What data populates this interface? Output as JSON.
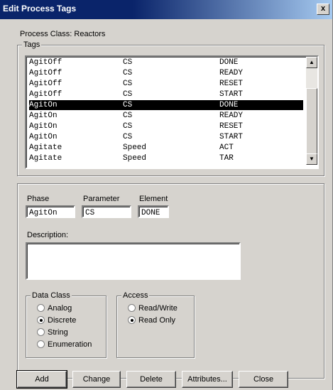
{
  "window": {
    "title": "Edit Process Tags",
    "close_glyph": "x"
  },
  "process_class": "Process Class: Reactors",
  "tags_group_label": "Tags",
  "tags": [
    {
      "phase": "AgitOff",
      "parameter": "CS",
      "element": "DONE",
      "selected": false
    },
    {
      "phase": "AgitOff",
      "parameter": "CS",
      "element": "READY",
      "selected": false
    },
    {
      "phase": "AgitOff",
      "parameter": "CS",
      "element": "RESET",
      "selected": false
    },
    {
      "phase": "AgitOff",
      "parameter": "CS",
      "element": "START",
      "selected": false
    },
    {
      "phase": "AgitOn",
      "parameter": "CS",
      "element": "DONE",
      "selected": true
    },
    {
      "phase": "AgitOn",
      "parameter": "CS",
      "element": "READY",
      "selected": false
    },
    {
      "phase": "AgitOn",
      "parameter": "CS",
      "element": "RESET",
      "selected": false
    },
    {
      "phase": "AgitOn",
      "parameter": "CS",
      "element": "START",
      "selected": false
    },
    {
      "phase": "Agitate",
      "parameter": "Speed",
      "element": "ACT",
      "selected": false
    },
    {
      "phase": "Agitate",
      "parameter": "Speed",
      "element": "TAR",
      "selected": false
    }
  ],
  "fields": {
    "phase_label": "Phase",
    "phase_value": "AgitOn",
    "parameter_label": "Parameter",
    "parameter_value": "CS",
    "element_label": "Element",
    "element_value": "DONE",
    "description_label": "Description:",
    "description_value": ""
  },
  "data_class": {
    "label": "Data Class",
    "options": [
      "Analog",
      "Discrete",
      "String",
      "Enumeration"
    ],
    "selected": "Discrete"
  },
  "access": {
    "label": "Access",
    "options": [
      "Read/Write",
      "Read Only"
    ],
    "selected": "Read Only"
  },
  "buttons": {
    "add": "Add",
    "change": "Change",
    "delete": "Delete",
    "attributes": "Attributes...",
    "close": "Close"
  },
  "icons": {
    "scroll_up": "scroll-up-icon",
    "scroll_down": "scroll-down-icon"
  }
}
